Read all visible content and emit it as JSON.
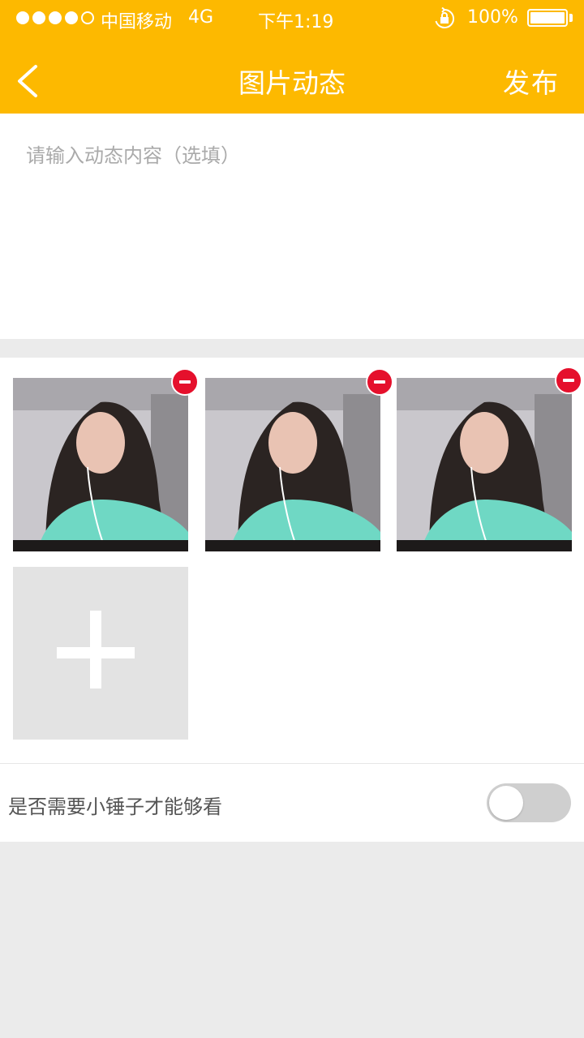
{
  "status_bar": {
    "carrier": "中国移动",
    "network": "4G",
    "time": "下午1:19",
    "battery": "100%",
    "battery_level": 1.0,
    "signal_bars": 4
  },
  "header": {
    "title": "图片动态",
    "publish_label": "发布",
    "back_icon": "chevron-left-icon",
    "background_color": "#fdb900"
  },
  "content_input": {
    "placeholder": "请输入动态内容（选填）",
    "value": ""
  },
  "photos": [
    {
      "name": "photo-1",
      "remove_icon": "minus-circle-icon"
    },
    {
      "name": "photo-2",
      "remove_icon": "minus-circle-icon"
    },
    {
      "name": "photo-3",
      "remove_icon": "minus-circle-icon"
    }
  ],
  "add_photo": {
    "icon": "plus-icon"
  },
  "toggle": {
    "label": "是否需要小锤子才能够看",
    "on": false
  },
  "colors": {
    "accent": "#fdb900",
    "remove": "#e5102c",
    "background": "#ebebeb"
  }
}
